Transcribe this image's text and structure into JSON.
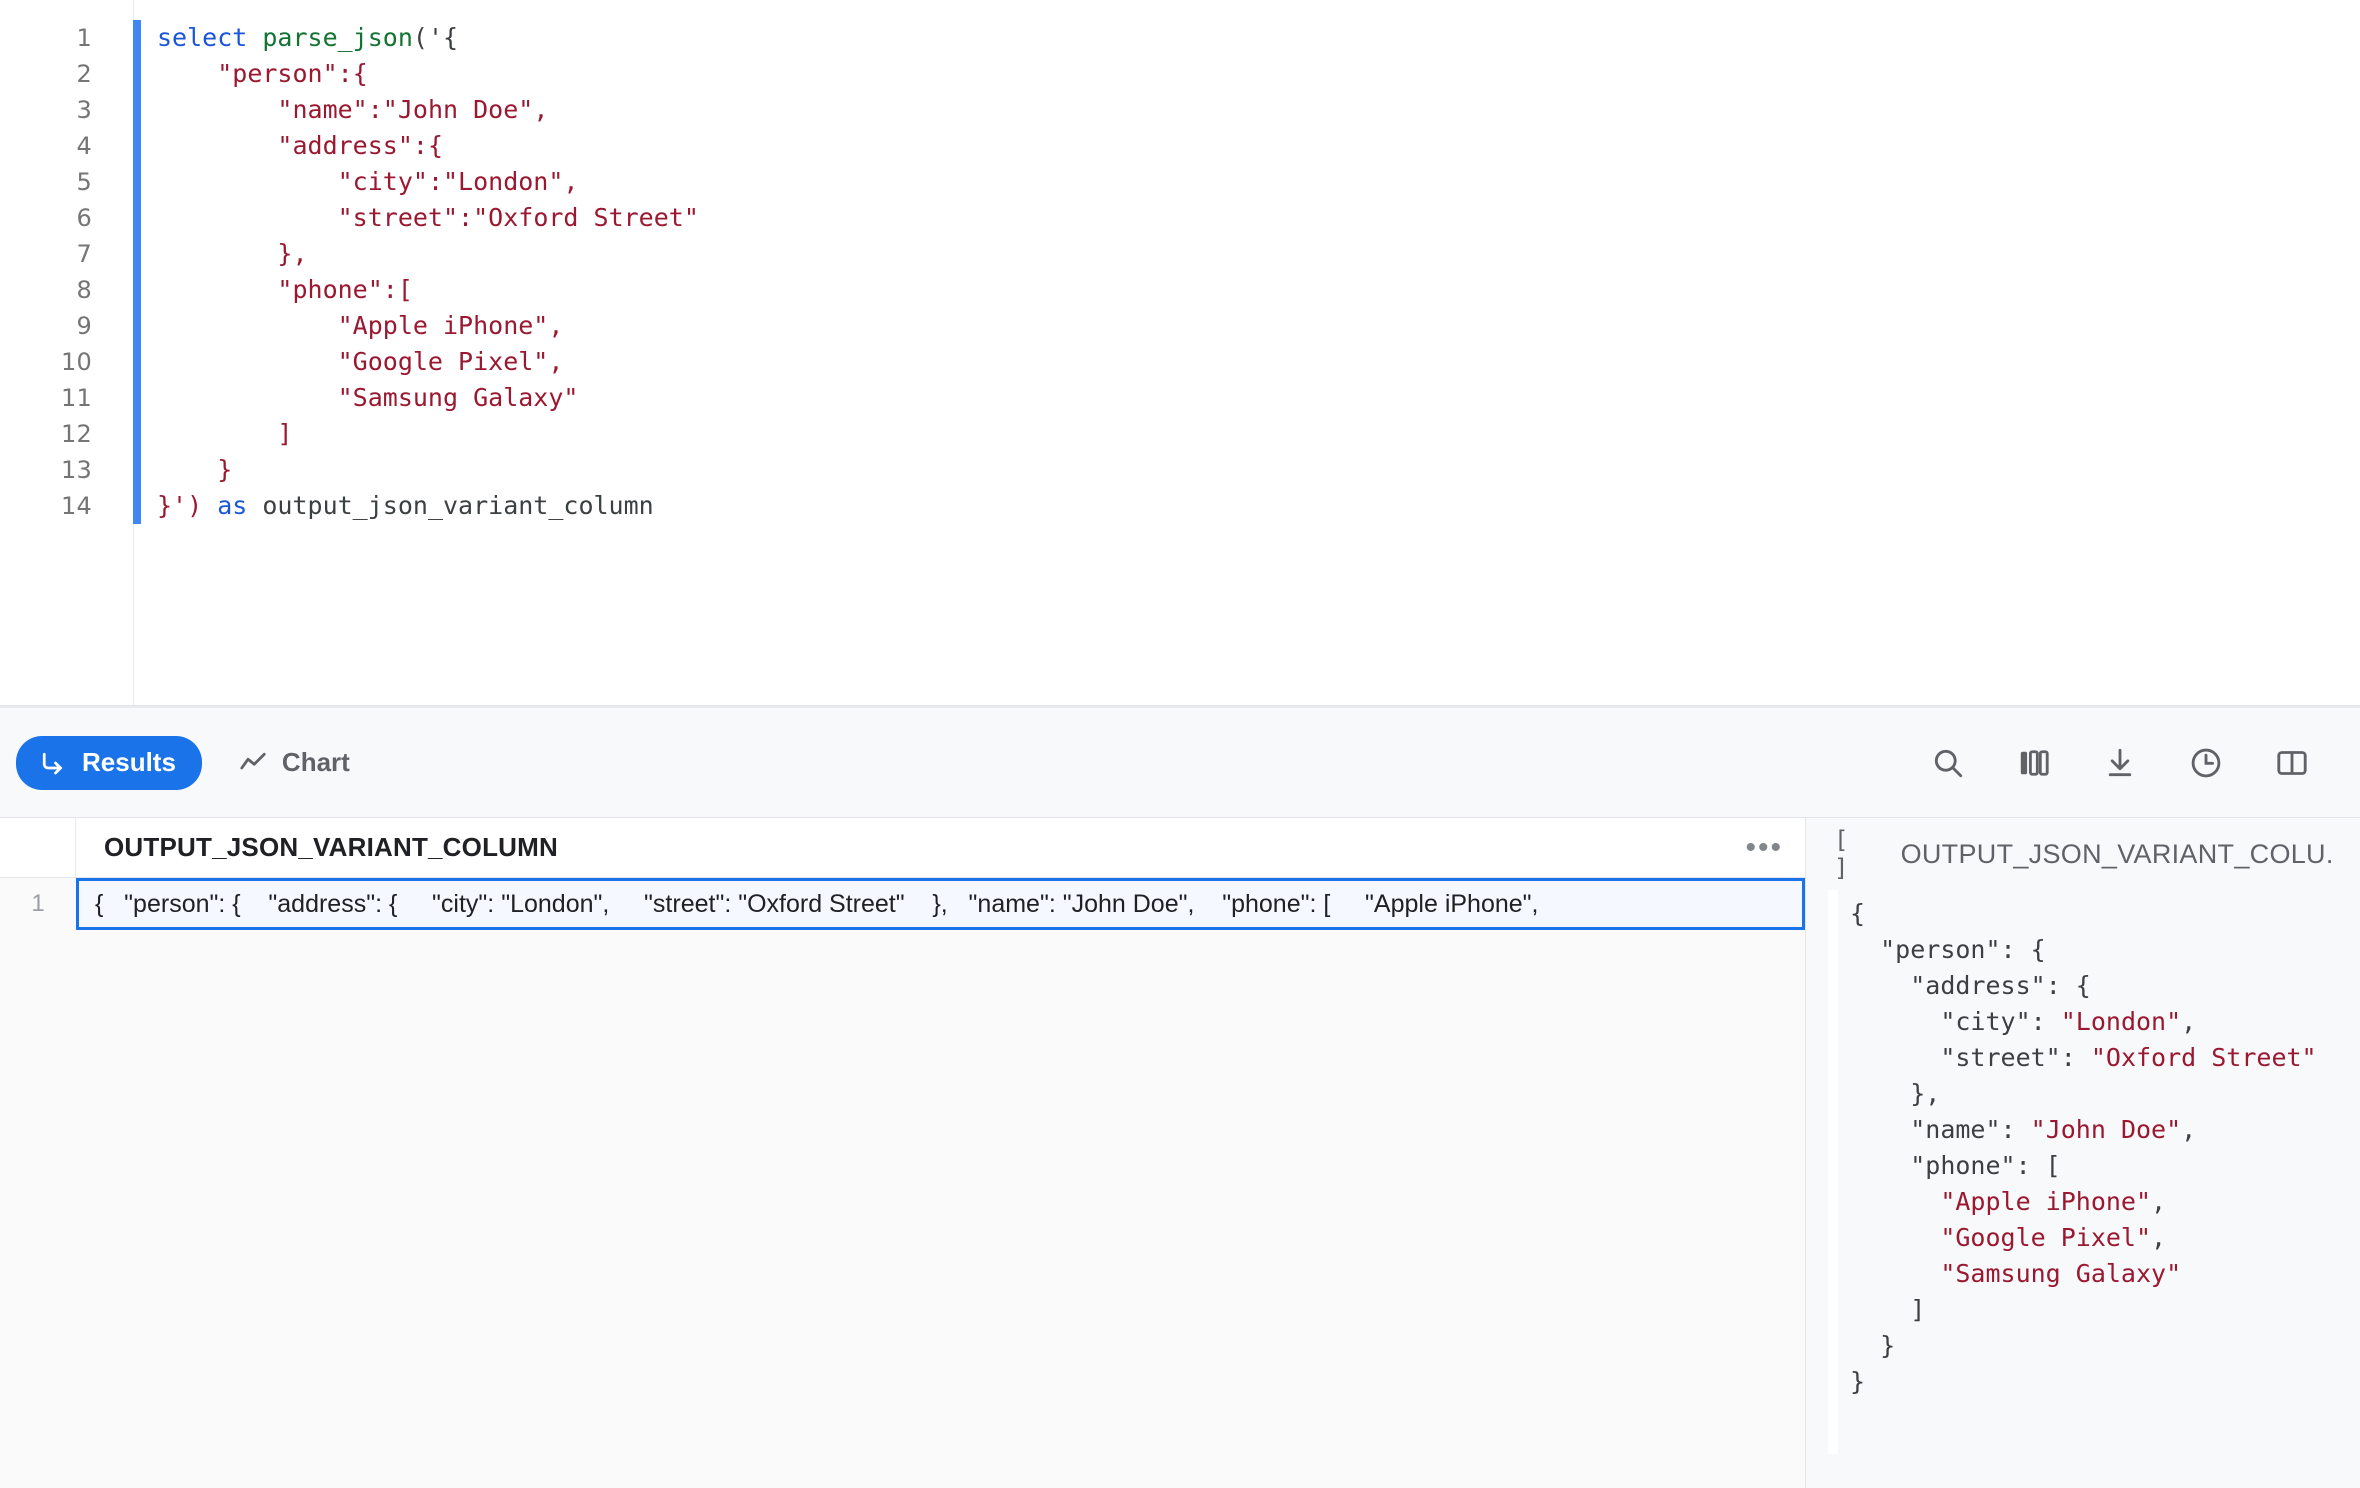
{
  "editor": {
    "lines": [
      {
        "num": "1",
        "accent": true,
        "tokens": [
          {
            "t": "select",
            "c": "kw"
          },
          {
            "t": " ",
            "c": "pl"
          },
          {
            "t": "parse_json",
            "c": "fn"
          },
          {
            "t": "('{",
            "c": "pl"
          }
        ]
      },
      {
        "num": "2",
        "accent": true,
        "tokens": [
          {
            "t": "    ",
            "c": "pl"
          },
          {
            "t": "\"person\"",
            "c": "str"
          },
          {
            "t": ":{",
            "c": "str"
          }
        ]
      },
      {
        "num": "3",
        "accent": true,
        "tokens": [
          {
            "t": "        ",
            "c": "pl"
          },
          {
            "t": "\"name\"",
            "c": "str"
          },
          {
            "t": ":",
            "c": "str"
          },
          {
            "t": "\"John Doe\"",
            "c": "str"
          },
          {
            "t": ",",
            "c": "str"
          }
        ]
      },
      {
        "num": "4",
        "accent": true,
        "tokens": [
          {
            "t": "        ",
            "c": "pl"
          },
          {
            "t": "\"address\"",
            "c": "str"
          },
          {
            "t": ":{",
            "c": "str"
          }
        ]
      },
      {
        "num": "5",
        "accent": true,
        "tokens": [
          {
            "t": "            ",
            "c": "pl"
          },
          {
            "t": "\"city\"",
            "c": "str"
          },
          {
            "t": ":",
            "c": "str"
          },
          {
            "t": "\"London\"",
            "c": "str"
          },
          {
            "t": ",",
            "c": "str"
          }
        ]
      },
      {
        "num": "6",
        "accent": true,
        "tokens": [
          {
            "t": "            ",
            "c": "pl"
          },
          {
            "t": "\"street\"",
            "c": "str"
          },
          {
            "t": ":",
            "c": "str"
          },
          {
            "t": "\"Oxford Street\"",
            "c": "str"
          }
        ]
      },
      {
        "num": "7",
        "accent": true,
        "tokens": [
          {
            "t": "        ",
            "c": "pl"
          },
          {
            "t": "},",
            "c": "str"
          }
        ]
      },
      {
        "num": "8",
        "accent": true,
        "tokens": [
          {
            "t": "        ",
            "c": "pl"
          },
          {
            "t": "\"phone\"",
            "c": "str"
          },
          {
            "t": ":[",
            "c": "str"
          }
        ]
      },
      {
        "num": "9",
        "accent": true,
        "tokens": [
          {
            "t": "            ",
            "c": "pl"
          },
          {
            "t": "\"Apple iPhone\"",
            "c": "str"
          },
          {
            "t": ",",
            "c": "str"
          }
        ]
      },
      {
        "num": "10",
        "accent": true,
        "tokens": [
          {
            "t": "            ",
            "c": "pl"
          },
          {
            "t": "\"Google Pixel\"",
            "c": "str"
          },
          {
            "t": ",",
            "c": "str"
          }
        ]
      },
      {
        "num": "11",
        "accent": true,
        "tokens": [
          {
            "t": "            ",
            "c": "pl"
          },
          {
            "t": "\"Samsung Galaxy\"",
            "c": "str"
          }
        ]
      },
      {
        "num": "12",
        "accent": true,
        "tokens": [
          {
            "t": "        ",
            "c": "pl"
          },
          {
            "t": "]",
            "c": "str"
          }
        ]
      },
      {
        "num": "13",
        "accent": true,
        "tokens": [
          {
            "t": "    ",
            "c": "pl"
          },
          {
            "t": "}",
            "c": "str"
          }
        ]
      },
      {
        "num": "14",
        "accent": true,
        "tokens": [
          {
            "t": "}')",
            "c": "str"
          },
          {
            "t": " ",
            "c": "pl"
          },
          {
            "t": "as",
            "c": "kw"
          },
          {
            "t": " output_json_variant_column",
            "c": "pl"
          }
        ]
      }
    ],
    "full_text": "select parse_json('{\n    \"person\":{\n        \"name\":\"John Doe\",\n        \"address\":{\n            \"city\":\"London\",\n            \"street\":\"Oxford Street\"\n        },\n        \"phone\":[\n            \"Apple iPhone\",\n            \"Google Pixel\",\n            \"Samsung Galaxy\"\n        ]\n    }\n}') as output_json_variant_column"
  },
  "toolbar": {
    "results_label": "Results",
    "chart_label": "Chart",
    "results_icon": "return-arrow-icon",
    "chart_icon": "line-chart-icon",
    "icons": [
      {
        "name": "search-icon",
        "title": "Search"
      },
      {
        "name": "columns-icon",
        "title": "Columns"
      },
      {
        "name": "download-icon",
        "title": "Download"
      },
      {
        "name": "history-clock-icon",
        "title": "History"
      },
      {
        "name": "split-panel-icon",
        "title": "Toggle panel"
      }
    ],
    "accent_color": "#1a73e8",
    "background": "#f8f9fa"
  },
  "grid": {
    "columns": [
      "OUTPUT_JSON_VARIANT_COLUMN"
    ],
    "more_label": "•••",
    "rows": [
      {
        "num": "1",
        "cells": [
          "{   \"person\": {    \"address\": {     \"city\": \"London\",     \"street\": \"Oxford Street\"    },   \"name\": \"John Doe\",    \"phone\": [     \"Apple iPhone\","
        ]
      }
    ],
    "selection_color": "#1a73e8",
    "selection_fill": "#f5f9ff"
  },
  "detail": {
    "type_badge": "[ ]",
    "title": "OUTPUT_JSON_VARIANT_COLU...",
    "json_lines": [
      [
        {
          "t": "{",
          "c": "punc"
        }
      ],
      [
        {
          "t": "  ",
          "c": "punc"
        },
        {
          "t": "\"person\"",
          "c": "key"
        },
        {
          "t": ": {",
          "c": "punc"
        }
      ],
      [
        {
          "t": "    ",
          "c": "punc"
        },
        {
          "t": "\"address\"",
          "c": "key"
        },
        {
          "t": ": {",
          "c": "punc"
        }
      ],
      [
        {
          "t": "      ",
          "c": "punc"
        },
        {
          "t": "\"city\"",
          "c": "key"
        },
        {
          "t": ": ",
          "c": "punc"
        },
        {
          "t": "\"London\"",
          "c": "str"
        },
        {
          "t": ",",
          "c": "punc"
        }
      ],
      [
        {
          "t": "      ",
          "c": "punc"
        },
        {
          "t": "\"street\"",
          "c": "key"
        },
        {
          "t": ": ",
          "c": "punc"
        },
        {
          "t": "\"Oxford Street\"",
          "c": "str"
        }
      ],
      [
        {
          "t": "    },",
          "c": "punc"
        }
      ],
      [
        {
          "t": "    ",
          "c": "punc"
        },
        {
          "t": "\"name\"",
          "c": "key"
        },
        {
          "t": ": ",
          "c": "punc"
        },
        {
          "t": "\"John Doe\"",
          "c": "str"
        },
        {
          "t": ",",
          "c": "punc"
        }
      ],
      [
        {
          "t": "    ",
          "c": "punc"
        },
        {
          "t": "\"phone\"",
          "c": "key"
        },
        {
          "t": ": [",
          "c": "punc"
        }
      ],
      [
        {
          "t": "      ",
          "c": "punc"
        },
        {
          "t": "\"Apple iPhone\"",
          "c": "str"
        },
        {
          "t": ",",
          "c": "punc"
        }
      ],
      [
        {
          "t": "      ",
          "c": "punc"
        },
        {
          "t": "\"Google Pixel\"",
          "c": "str"
        },
        {
          "t": ",",
          "c": "punc"
        }
      ],
      [
        {
          "t": "      ",
          "c": "punc"
        },
        {
          "t": "\"Samsung Galaxy\"",
          "c": "str"
        }
      ],
      [
        {
          "t": "    ]",
          "c": "punc"
        }
      ],
      [
        {
          "t": "  }",
          "c": "punc"
        }
      ],
      [
        {
          "t": "}",
          "c": "punc"
        }
      ]
    ]
  }
}
